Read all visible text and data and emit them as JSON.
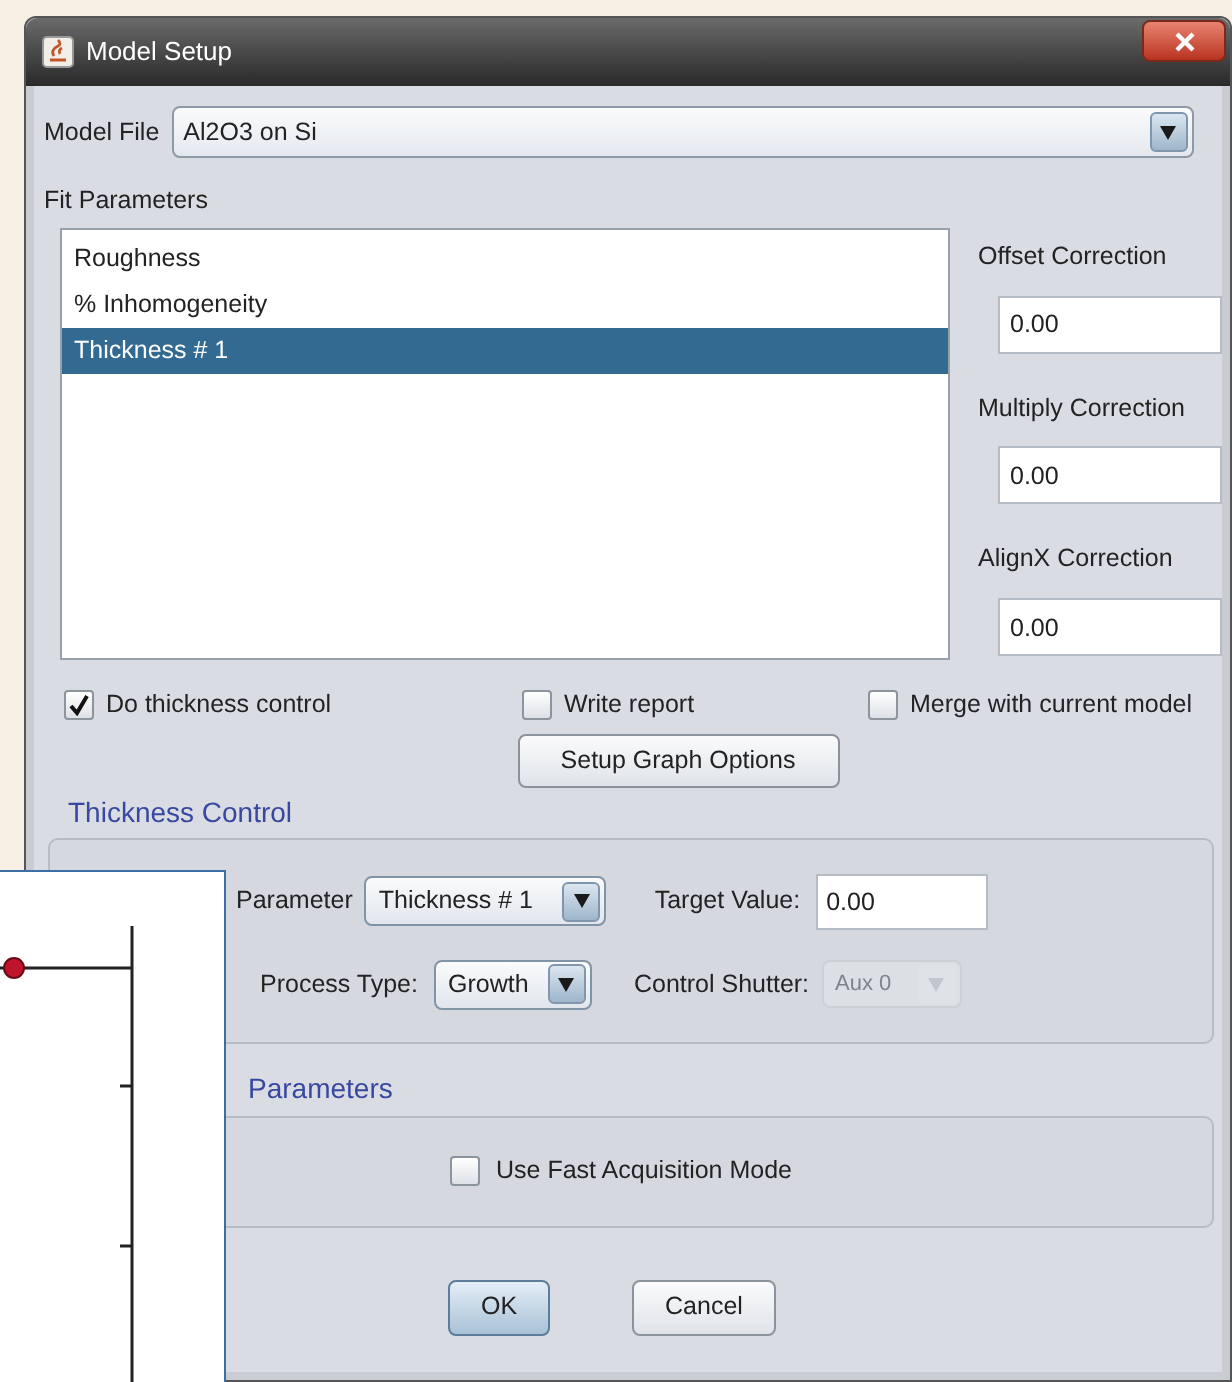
{
  "window": {
    "title": "Model Setup"
  },
  "model_file": {
    "label": "Model File",
    "value": "Al2O3 on Si"
  },
  "fit_parameters": {
    "label": "Fit Parameters",
    "items": [
      {
        "label": "Roughness",
        "selected": false
      },
      {
        "label": "% Inhomogeneity",
        "selected": false
      },
      {
        "label": "Thickness # 1",
        "selected": true
      }
    ]
  },
  "corrections": [
    {
      "label": "Offset Correction",
      "value": "0.00"
    },
    {
      "label": "Multiply Correction",
      "value": "0.00"
    },
    {
      "label": "AlignX Correction",
      "value": "0.00"
    }
  ],
  "options": [
    {
      "label": "Do thickness control",
      "checked": true
    },
    {
      "label": "Write report",
      "checked": false
    },
    {
      "label": "Merge with current model",
      "checked": false
    }
  ],
  "setup_graph_button": "Setup Graph Options",
  "thickness_control": {
    "title": "Thickness Control",
    "parameter_label": "Parameter",
    "parameter_value": "Thickness # 1",
    "target_label": "Target Value:",
    "target_value": "0.00",
    "process_label": "Process Type:",
    "process_value": "Growth",
    "shutter_label": "Control Shutter:",
    "shutter_value": "Aux 0",
    "shutter_disabled": true
  },
  "acquisition": {
    "title": "Parameters",
    "fast_mode": {
      "label": "Use Fast Acquisition Mode",
      "checked": false
    }
  },
  "buttons": [
    {
      "label": "OK",
      "default": true
    },
    {
      "label": "Cancel",
      "default": false
    }
  ]
}
